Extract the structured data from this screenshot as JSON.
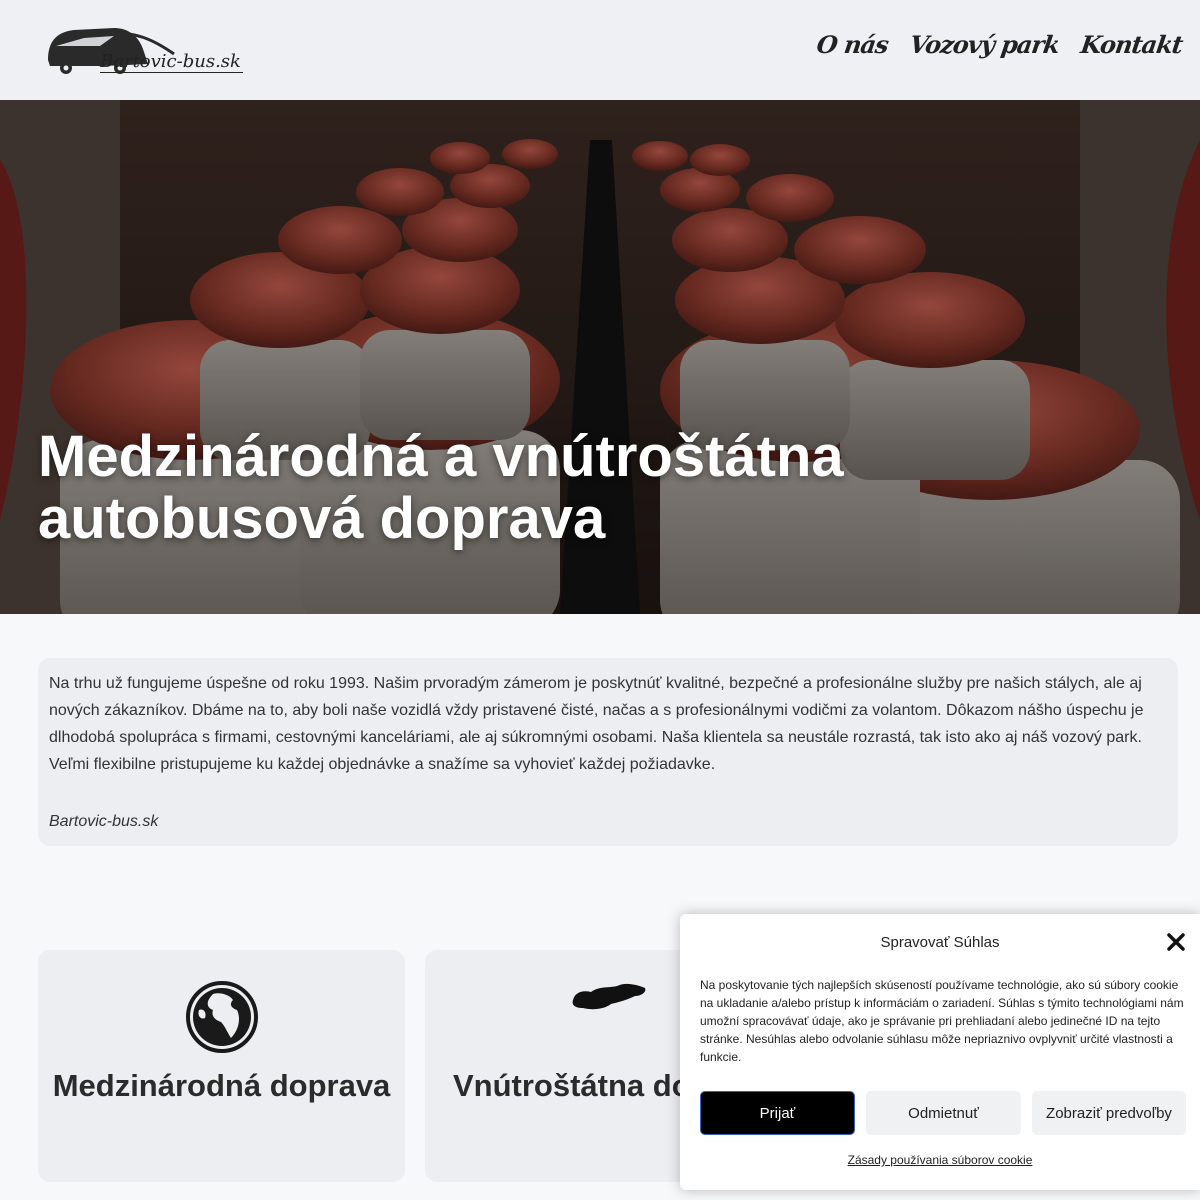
{
  "header": {
    "logo_text": "Bartovic-bus.sk",
    "nav": [
      {
        "label": "O nás"
      },
      {
        "label": "Vozový park"
      },
      {
        "label": "Kontakt"
      }
    ]
  },
  "hero": {
    "title_line1": "Medzinárodná a vnútroštátna",
    "title_line2": "autobusová doprava"
  },
  "intro": {
    "text": "Na trhu už fungujeme úspešne od roku 1993. Našim prvoradým zámerom je poskytnúť kvalitné, bezpečné a profesionálne služby pre našich stálych, ale aj nových zákazníkov. Dbáme na to, aby boli naše vozidlá vždy pristavené čisté, načas a s profesionálnymi vodičmi za volantom. Dôkazom nášho úspechu je dlhodobá spolupráca s firmami, cestovnými kanceláriami, ale aj súkromnými osobami. Naša klientela sa neustále rozrastá, tak isto ako aj náš vozový park. Veľmi flexibilne pristupujeme ku každej objednávke a snažíme sa vyhovieť každej požiadavke.",
    "signature": "Bartovic-bus.sk"
  },
  "cards": [
    {
      "title": "Medzinárodná doprava",
      "icon": "globe-icon"
    },
    {
      "title": "Vnútroštátna doprava",
      "icon": "slovakia-map-icon"
    }
  ],
  "consent": {
    "title": "Spravovať Súhlas",
    "text": "Na poskytovanie tých najlepších skúseností používame technológie, ako sú súbory cookie na ukladanie a/alebo prístup k informáciám o zariadení. Súhlas s týmito technológiami nám umožní spracovávať údaje, ako je správanie pri prehliadaní alebo jedinečné ID na tejto stránke. Nesúhlas alebo odvolanie súhlasu môže nepriaznivo ovplyvniť určité vlastnosti a funkcie.",
    "accept_label": "Prijať",
    "deny_label": "Odmietnuť",
    "prefs_label": "Zobraziť predvoľby",
    "policy_label": "Zásady používania súborov cookie"
  },
  "colors": {
    "accent": "#000000",
    "seat_leather": "#8a3b2e",
    "panel_bg": "#eceef1"
  }
}
